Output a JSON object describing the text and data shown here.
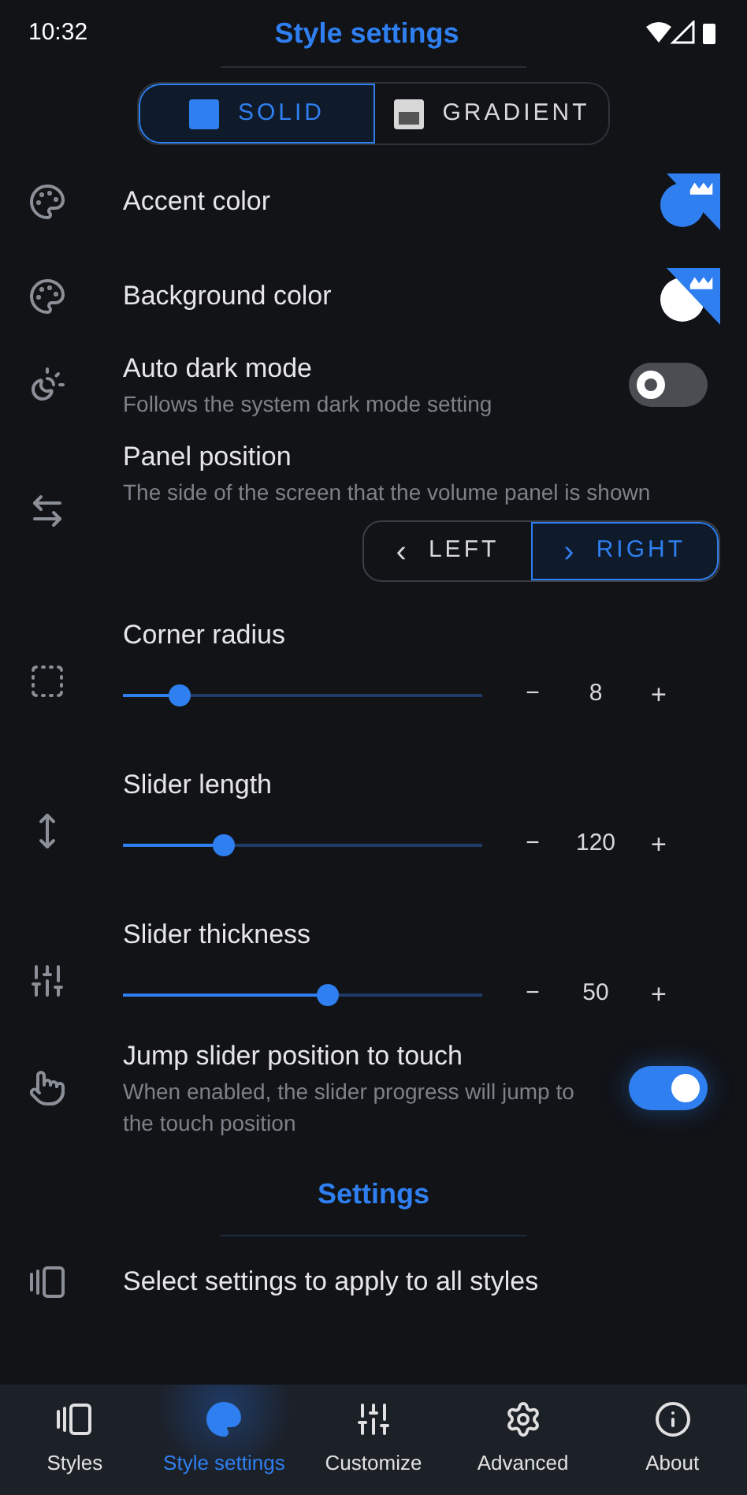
{
  "status_bar": {
    "time": "10:32"
  },
  "title": "Style settings",
  "style_tabs": [
    {
      "label": "SOLID",
      "kind": "solid",
      "selected": true
    },
    {
      "label": "GRADIENT",
      "kind": "gradient",
      "selected": false
    }
  ],
  "rows": [
    {
      "kind": "color",
      "title": "Accent color",
      "color": "#2f7ff0"
    },
    {
      "kind": "color",
      "title": "Background color",
      "color": "#ffffff"
    },
    {
      "kind": "toggle",
      "title": "Auto dark mode",
      "subtitle": "Follows the system dark mode setting",
      "on": false
    },
    {
      "kind": "choice",
      "title": "Panel position",
      "subtitle": "The side of the screen that the volume panel is shown",
      "options": [
        {
          "label": "LEFT",
          "glyph": "‹",
          "selected": false
        },
        {
          "label": "RIGHT",
          "glyph": "›",
          "selected": true
        }
      ]
    },
    {
      "kind": "slider",
      "title": "Corner radius",
      "level": 0.16,
      "value": "8",
      "minus": "−",
      "plus": "+"
    },
    {
      "kind": "slider",
      "title": "Slider length",
      "level": 0.28,
      "value": "120",
      "minus": "−",
      "plus": "+"
    },
    {
      "kind": "slider",
      "title": "Slider thickness",
      "level": 0.57,
      "value": "50",
      "minus": "−",
      "plus": "+"
    },
    {
      "kind": "toggle",
      "title": "Jump slider position to touch",
      "subtitle": "When enabled, the slider progress will jump to the touch position",
      "on": true
    }
  ],
  "section": "Settings",
  "apply_row": {
    "title": "Select settings to apply to all styles"
  },
  "nav": [
    {
      "label": "Styles",
      "selected": false
    },
    {
      "label": "Style settings",
      "selected": true
    },
    {
      "label": "Customize",
      "selected": false
    },
    {
      "label": "Advanced",
      "selected": false
    },
    {
      "label": "About",
      "selected": false
    }
  ]
}
